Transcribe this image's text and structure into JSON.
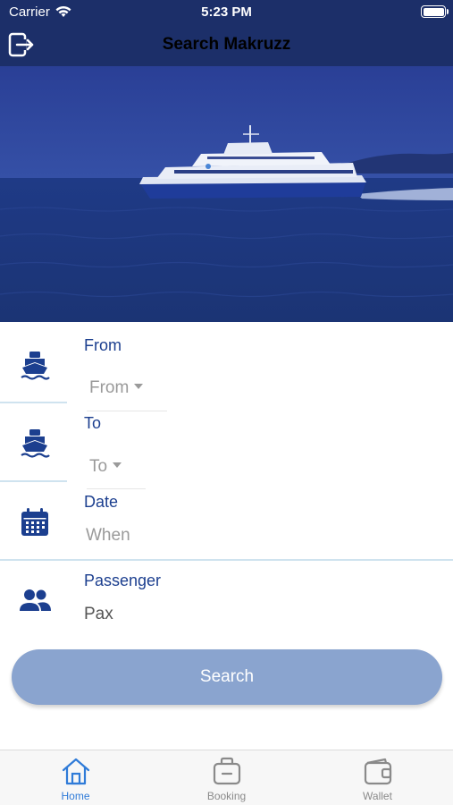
{
  "status_bar": {
    "carrier": "Carrier",
    "time": "5:23 PM"
  },
  "nav": {
    "title": "Search Makruzz",
    "logout_icon": "logout-icon"
  },
  "hero": {
    "description_icon": "ferry-photo"
  },
  "form": {
    "from": {
      "label": "From",
      "placeholder": "From",
      "icon": "ferry-icon"
    },
    "to": {
      "label": "To",
      "placeholder": "To",
      "icon": "ferry-icon"
    },
    "date": {
      "label": "Date",
      "placeholder": "When",
      "icon": "calendar-icon"
    },
    "passenger": {
      "label": "Passenger",
      "value": "Pax",
      "icon": "people-icon"
    }
  },
  "search_button": {
    "label": "Search"
  },
  "tabbar": {
    "items": [
      {
        "label": "Home",
        "icon": "home-icon",
        "active": true
      },
      {
        "label": "Booking",
        "icon": "bag-icon",
        "active": false
      },
      {
        "label": "Wallet",
        "icon": "wallet-icon",
        "active": false
      }
    ]
  },
  "colors": {
    "header_bg": "#1c2f69",
    "label_blue": "#1c3f8f",
    "button_bg": "#8aa4cf",
    "tab_active": "#2f7bd8",
    "tab_inactive": "#8a8a8a"
  }
}
